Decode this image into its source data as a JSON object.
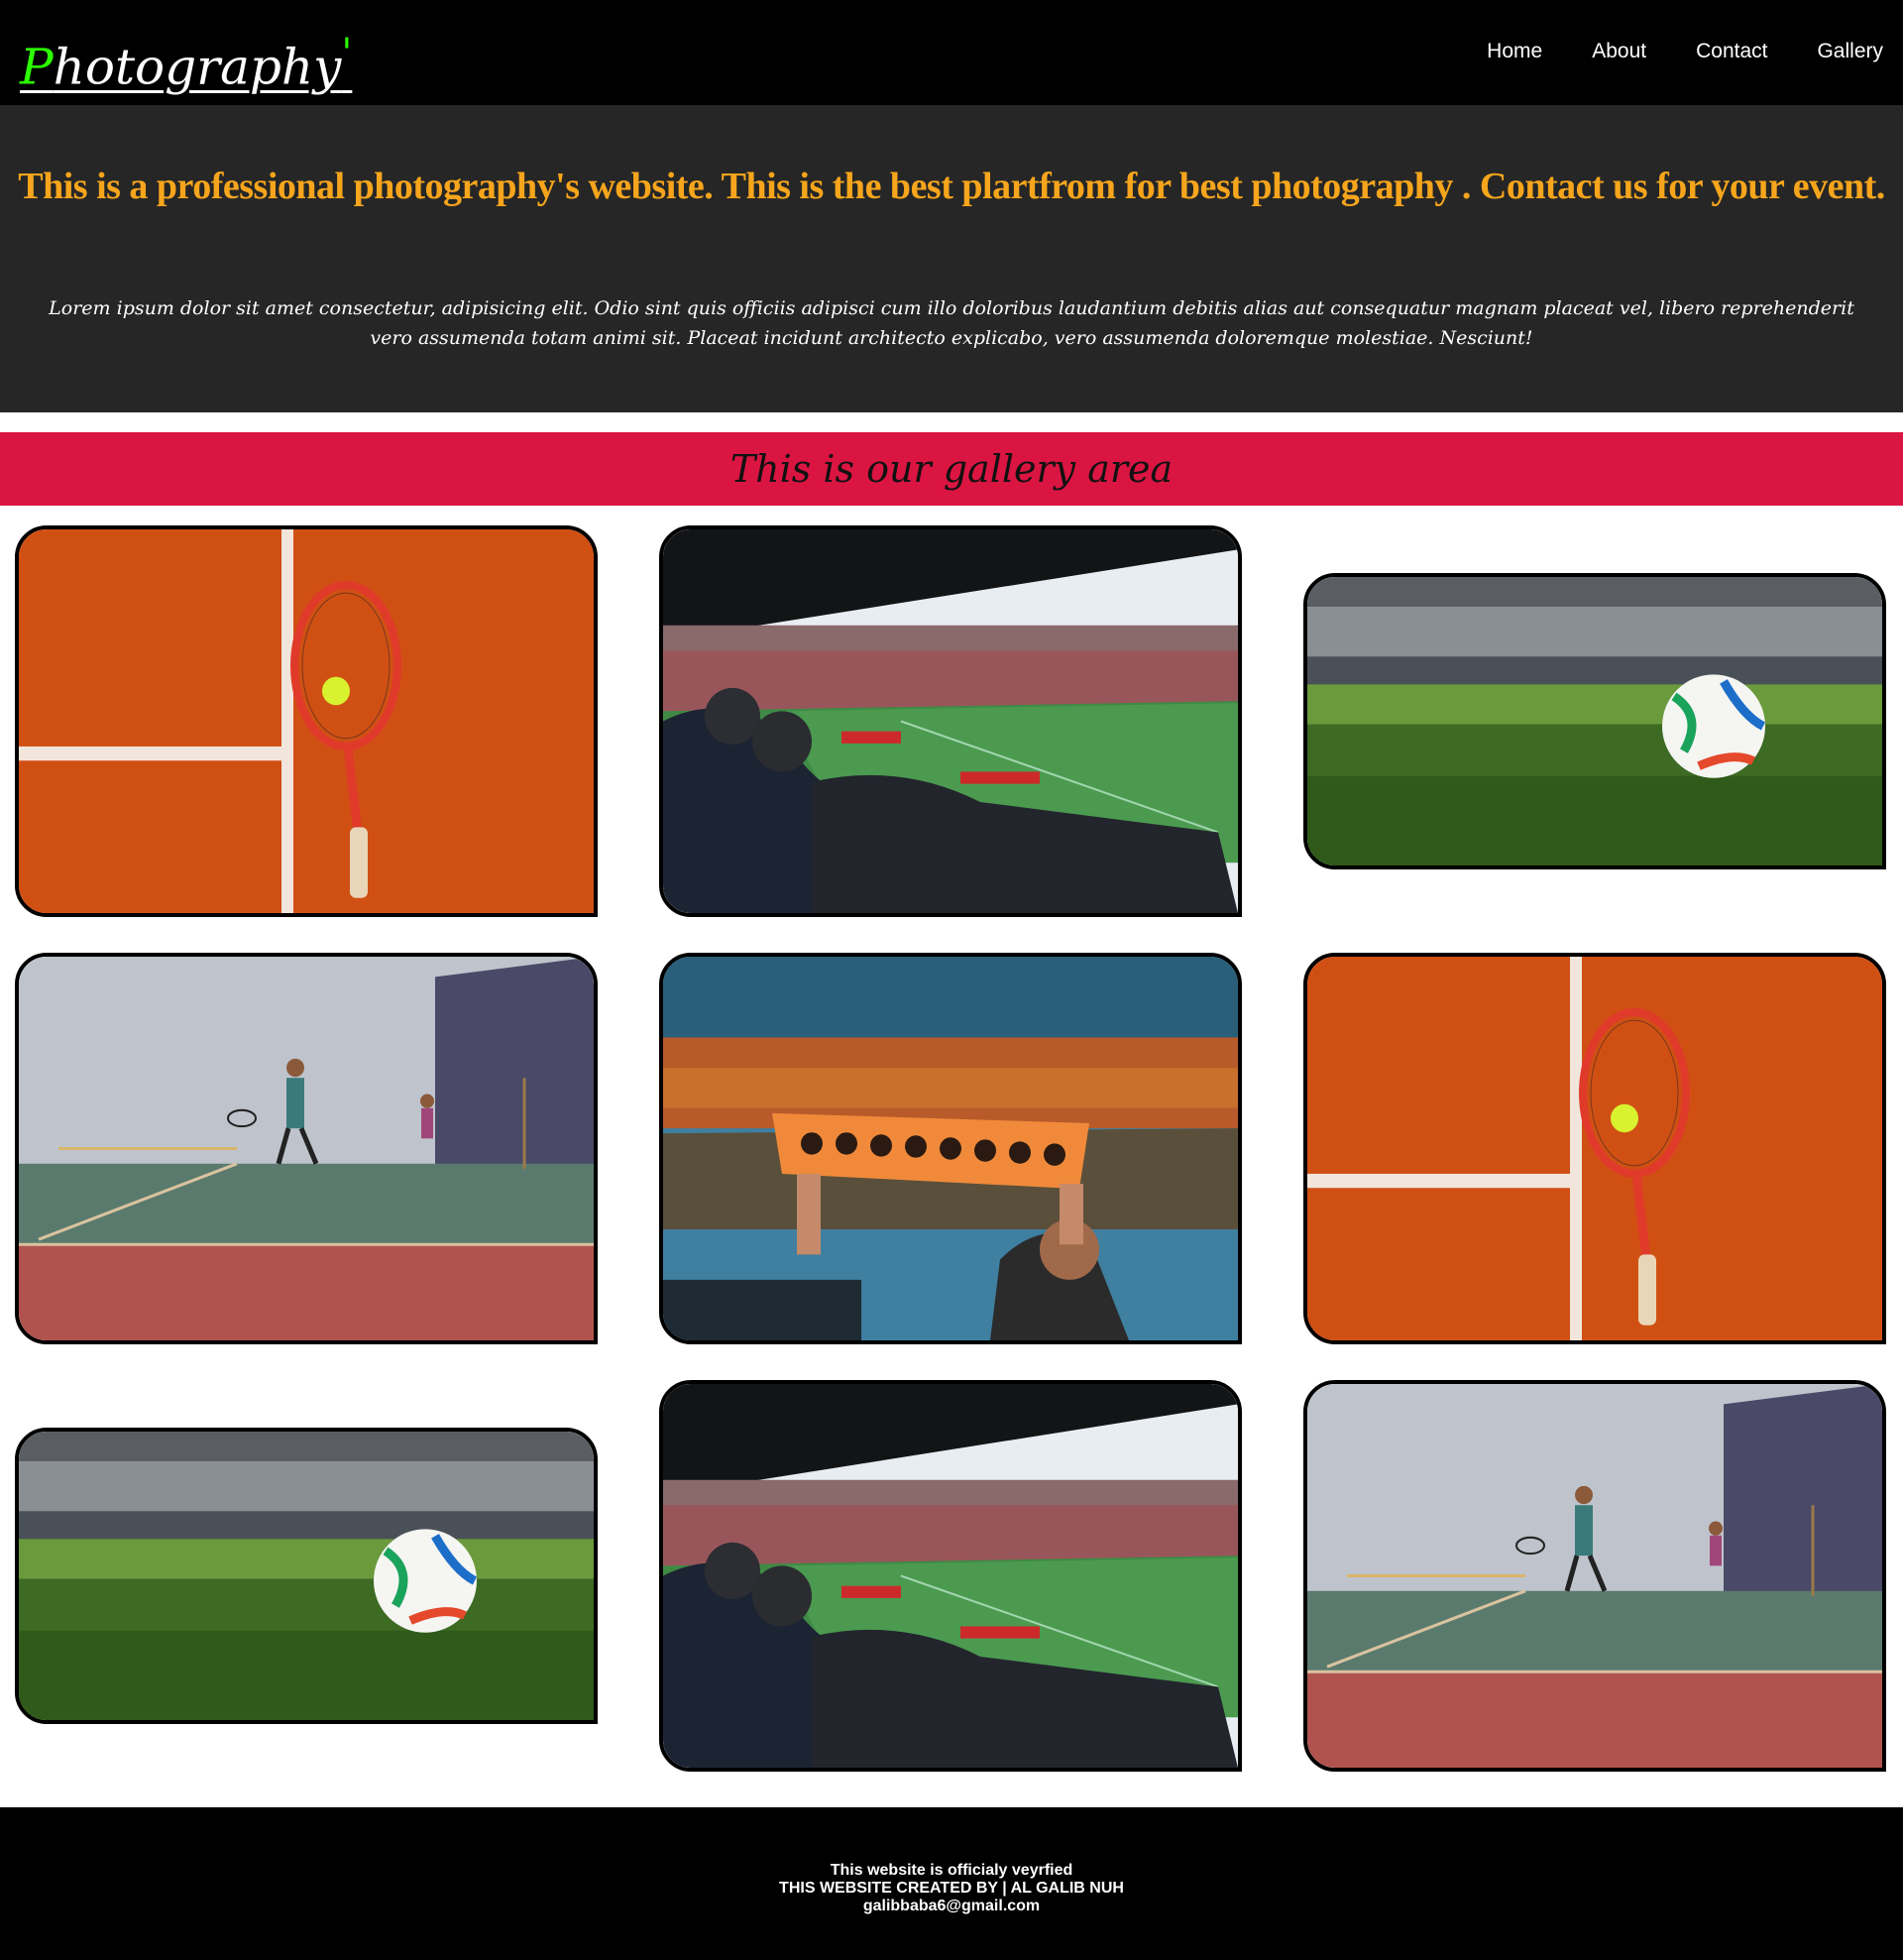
{
  "header": {
    "logo_first_letter": "P",
    "logo_rest": "hotography",
    "logo_tick": "'",
    "nav": [
      "Home",
      "About",
      "Contact",
      "Gallery"
    ]
  },
  "hero": {
    "title": "This is a professional photography's website. This is the best plartfrom for best photography . Contact us for your event.",
    "body": "Lorem ipsum dolor sit amet consectetur, adipisicing elit. Odio sint quis officiis adipisci cum illo doloribus laudantium debitis alias aut consequatur magnam placeat vel, libero reprehenderit vero assumenda totam animi sit. Placeat incidunt architecto explicabo, vero assumenda doloremque molestiae. Nesciunt!"
  },
  "gallery": {
    "heading": "This is our gallery area",
    "images": [
      {
        "subject": "tennis-racket-on-clay-court"
      },
      {
        "subject": "fans-in-football-stadium"
      },
      {
        "subject": "football-on-stadium-grass"
      },
      {
        "subject": "players-on-indoor-court"
      },
      {
        "subject": "fans-holding-banner"
      },
      {
        "subject": "tennis-racket-on-clay-court"
      },
      {
        "subject": "football-on-stadium-grass"
      },
      {
        "subject": "fans-in-football-stadium"
      },
      {
        "subject": "players-on-indoor-court"
      }
    ]
  },
  "footer": {
    "line1": "This website is officialy veyrfied",
    "line2": "THIS WEBSITE CREATED BY | AL GALIB NUH",
    "line3": "galibbaba6@gmail.com"
  },
  "colors": {
    "header_bg": "#000000",
    "hero_bg": "#262626",
    "hero_title": "#f6a51c",
    "banner_bg": "#db1542",
    "logo_accent": "#2cff00"
  }
}
